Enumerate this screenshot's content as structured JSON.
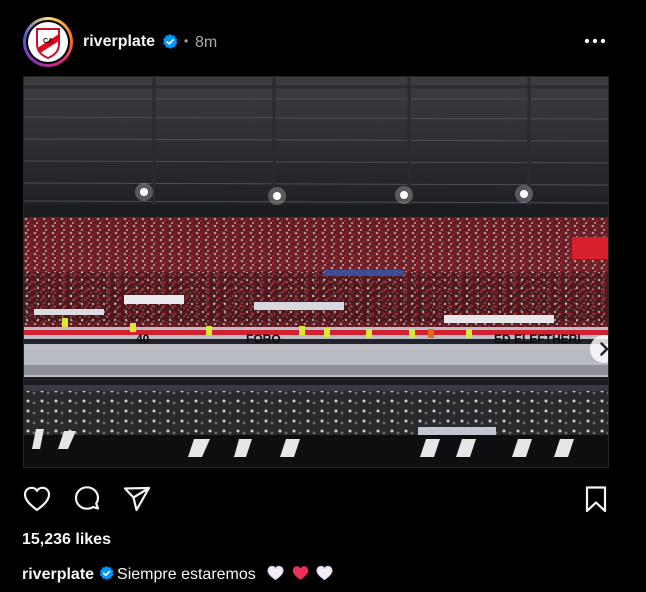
{
  "post": {
    "username": "riverplate",
    "time_separator": "•",
    "time": "8m",
    "verified_icon": "verified-badge-icon",
    "more_icon": "more-options-icon"
  },
  "media": {
    "description_icon": "stadium-photo",
    "next_icon": "chevron-right-icon"
  },
  "actions": {
    "like_icon": "heart-icon",
    "comment_icon": "comment-icon",
    "share_icon": "share-icon",
    "save_icon": "bookmark-icon"
  },
  "likes": {
    "text": "15,236 likes"
  },
  "caption": {
    "username": "riverplate",
    "text": "Siempre estaremos",
    "emojis": [
      "white-heart",
      "red-heart",
      "white-heart"
    ]
  },
  "colors": {
    "background": "#000000",
    "text_primary": "#f5f5f5",
    "text_secondary": "#a8a8a8",
    "verified": "#0095f6",
    "brand_red": "#e2001a"
  }
}
